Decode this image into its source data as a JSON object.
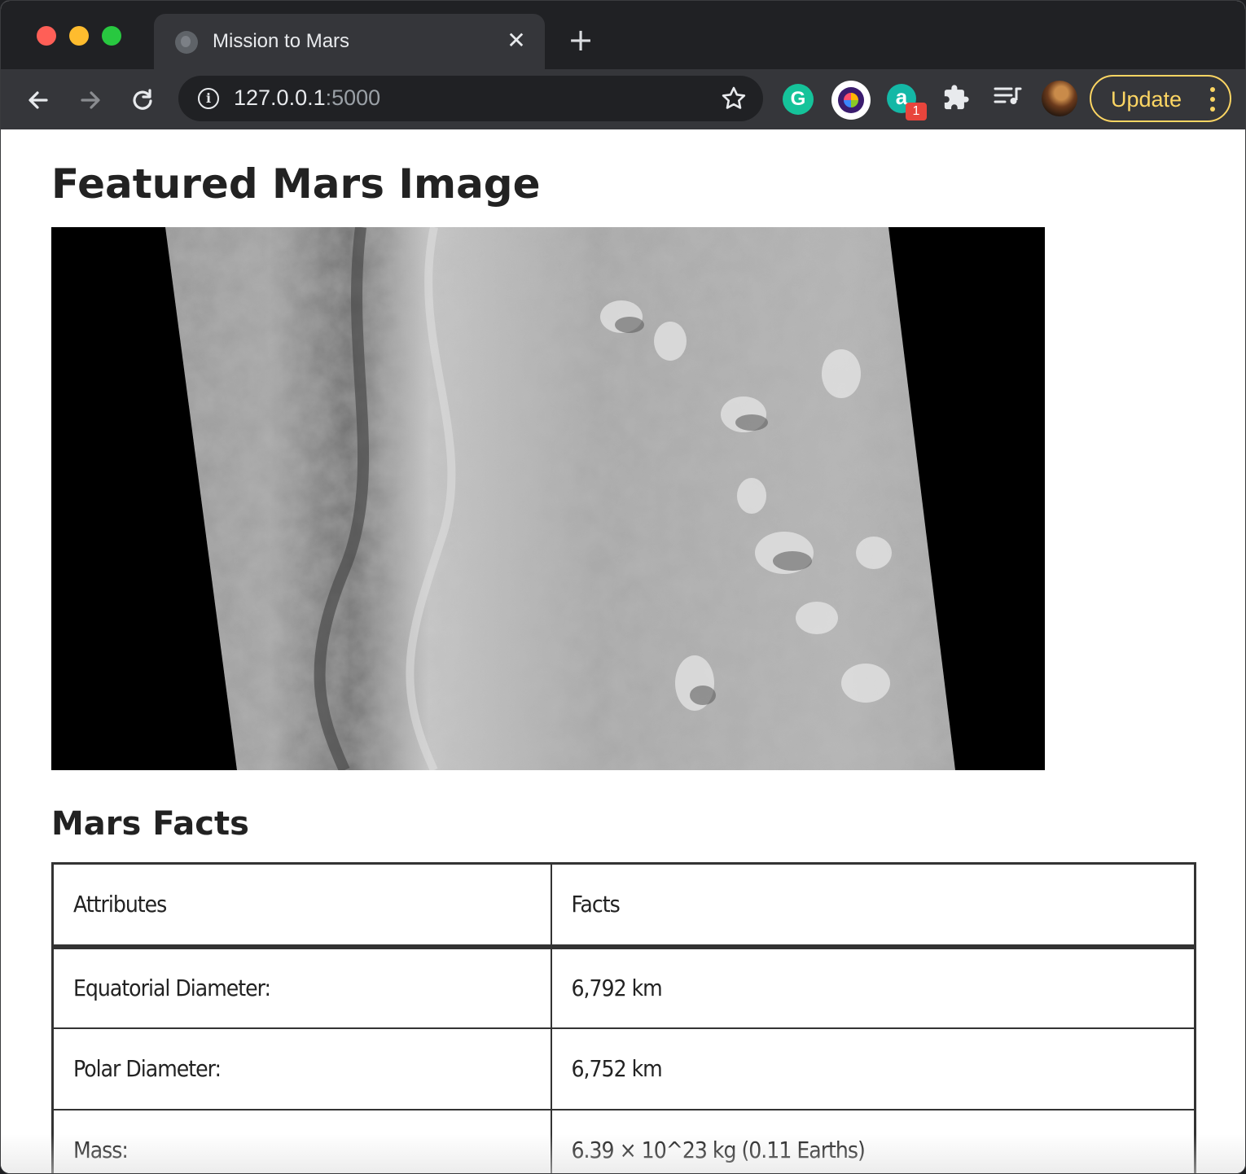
{
  "browser": {
    "tab_title": "Mission to Mars",
    "tab_close_glyph": "✕",
    "new_tab_glyph": "+",
    "url_host": "127.0.0.1",
    "url_port": ":5000",
    "update_label": "Update",
    "extension_badge": "1",
    "icons": [
      "back-arrow-icon",
      "forward-arrow-icon",
      "reload-icon",
      "info-icon",
      "star-icon",
      "grammarly-icon",
      "color-extension-icon",
      "a-extension-icon",
      "puzzle-icon",
      "media-queue-icon",
      "avatar",
      "more-menu-icon"
    ]
  },
  "page": {
    "featured_heading": "Featured Mars Image",
    "facts_heading": "Mars Facts",
    "table": {
      "headers": [
        "Attributes",
        "Facts"
      ],
      "rows": [
        [
          "Equatorial Diameter:",
          "6,792 km"
        ],
        [
          "Polar Diameter:",
          "6,752 km"
        ],
        [
          "Mass:",
          "6.39 × 10^23 kg (0.11 Earths)"
        ]
      ]
    }
  },
  "colors": {
    "tabstrip_bg": "#202124",
    "toolbar_bg": "#35363a",
    "update_accent": "#fdd663",
    "text": "#222222"
  }
}
